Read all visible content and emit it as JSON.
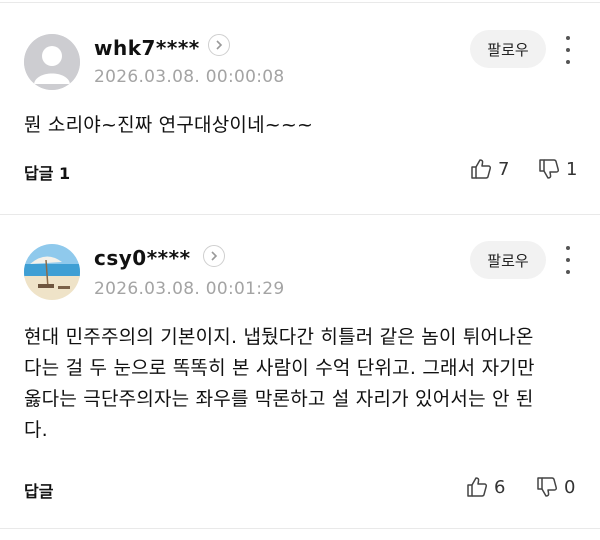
{
  "comments": [
    {
      "username": "whk7****",
      "timestamp": "2026.03.08. 00:00:08",
      "follow_label": "팔로우",
      "text": "뭔 소리야~진짜 연구대상이네~~~",
      "reply_label": "답글 1",
      "likes": "7",
      "dislikes": "1",
      "avatar": "default-profile-icon"
    },
    {
      "username": "csy0****",
      "timestamp": "2026.03.08. 00:01:29",
      "follow_label": "팔로우",
      "text": "현대 민주주의의 기본이지. 냅뒀다간 히틀러 같은 놈이 튀어나온다는 걸 두 눈으로 똑똑히 본 사람이 수억 단위고. 그래서 자기만 옳다는 극단주의자는 좌우를 막론하고 설 자리가 있어서는 안 된다.",
      "reply_label": "답글",
      "likes": "6",
      "dislikes": "0",
      "avatar": "beach-photo-avatar"
    }
  ],
  "colors": {
    "divider": "#e9e9e9",
    "timestamp": "#a4a4a4",
    "follow_bg": "#f2f2f2"
  }
}
